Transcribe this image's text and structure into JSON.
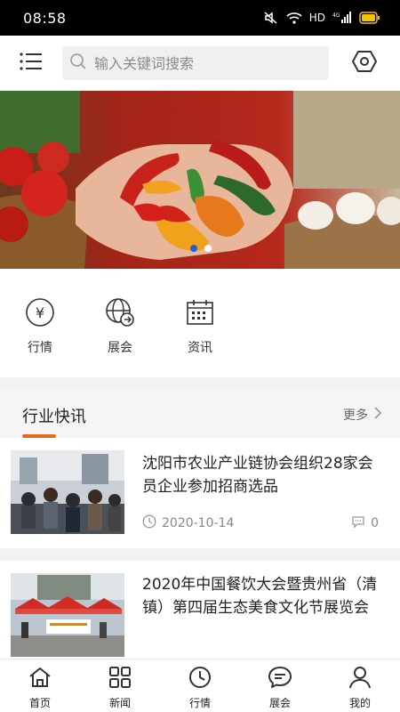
{
  "status_bar": {
    "time": "08:58",
    "network": "HD",
    "signal_type": "4G",
    "icons": [
      "mute-icon",
      "wifi-icon",
      "signal-icon",
      "battery-icon"
    ]
  },
  "header": {
    "search_placeholder": "输入关键词搜索",
    "icons": [
      "menu-icon",
      "search-icon",
      "settings-icon"
    ]
  },
  "banner": {
    "slide_count": 2,
    "active_slide": 1
  },
  "quick_nav": [
    {
      "label": "行情",
      "icon": "yen-circle-icon"
    },
    {
      "label": "展会",
      "icon": "globe-icon"
    },
    {
      "label": "资讯",
      "icon": "calendar-icon"
    }
  ],
  "news_section": {
    "title": "行业快讯",
    "more_label": "更多",
    "accent_color": "#e9681f",
    "items": [
      {
        "title": "沈阳市农业产业链协会组织28家会员企业参加招商选品",
        "date": "2020-10-14",
        "comments": "0"
      },
      {
        "title": "2020年中国餐饮大会暨贵州省（清镇）第四届生态美食文化节展览会"
      }
    ]
  },
  "bottom_nav": [
    {
      "label": "首页",
      "icon": "home-icon"
    },
    {
      "label": "新闻",
      "icon": "grid-icon"
    },
    {
      "label": "行情",
      "icon": "clock-icon"
    },
    {
      "label": "展会",
      "icon": "chat-icon"
    },
    {
      "label": "我的",
      "icon": "user-icon"
    }
  ]
}
